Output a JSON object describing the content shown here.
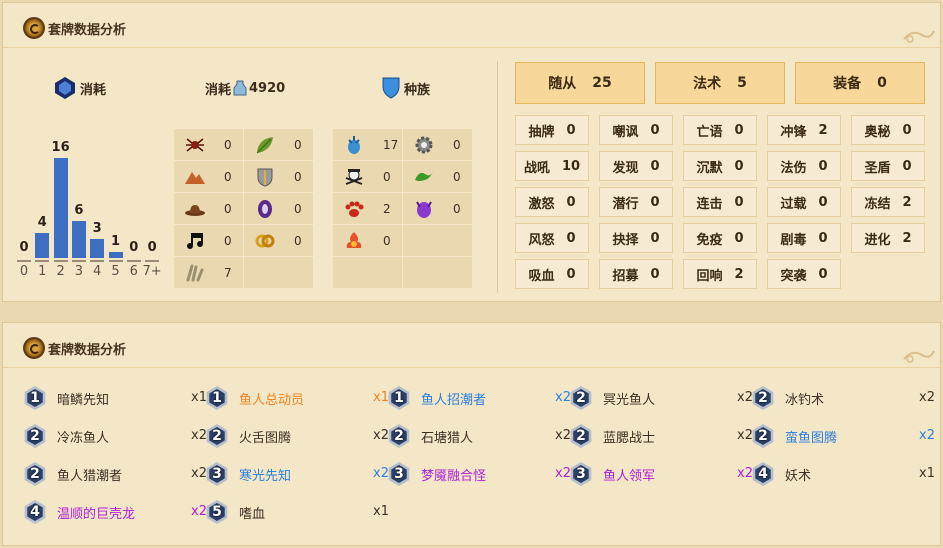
{
  "panel1": {
    "title": "套牌数据分析",
    "cost_header": "消耗",
    "dust_label": "消耗",
    "dust_value": "4920",
    "race_header": "种族"
  },
  "chart_data": {
    "type": "bar",
    "categories": [
      "0",
      "1",
      "2",
      "3",
      "4",
      "5",
      "6",
      "7+"
    ],
    "values": [
      0,
      4,
      16,
      6,
      3,
      1,
      0,
      0
    ],
    "title": "",
    "xlabel": "",
    "ylabel": "",
    "ylim": [
      0,
      16
    ]
  },
  "mechanic_grid": [
    {
      "icon": "spider-icon",
      "value": "0"
    },
    {
      "icon": "leaf-icon",
      "value": "0"
    },
    {
      "icon": "mountain-icon",
      "value": "0"
    },
    {
      "icon": "shield-icon",
      "value": "0"
    },
    {
      "icon": "hat-icon",
      "value": "0"
    },
    {
      "icon": "purple-rune-icon",
      "value": "0"
    },
    {
      "icon": "music-note-icon",
      "value": "0"
    },
    {
      "icon": "knot-icon",
      "value": "0"
    },
    {
      "icon": "claw-icon",
      "value": "7"
    }
  ],
  "race_grid": [
    {
      "icon": "murloc-icon",
      "value": "17"
    },
    {
      "icon": "mech-gear-icon",
      "value": "0"
    },
    {
      "icon": "pirate-icon",
      "value": "0"
    },
    {
      "icon": "dragon-icon",
      "value": "0"
    },
    {
      "icon": "beast-paw-icon",
      "value": "2"
    },
    {
      "icon": "demon-icon",
      "value": "0"
    },
    {
      "icon": "elemental-icon",
      "value": "0"
    }
  ],
  "type_totals": [
    {
      "label": "随从",
      "value": "25"
    },
    {
      "label": "法术",
      "value": "5"
    },
    {
      "label": "装备",
      "value": "0"
    }
  ],
  "keywords": [
    {
      "label": "抽牌",
      "value": "0"
    },
    {
      "label": "嘲讽",
      "value": "0"
    },
    {
      "label": "亡语",
      "value": "0"
    },
    {
      "label": "冲锋",
      "value": "2"
    },
    {
      "label": "奥秘",
      "value": "0"
    },
    {
      "label": "战吼",
      "value": "10"
    },
    {
      "label": "发现",
      "value": "0"
    },
    {
      "label": "沉默",
      "value": "0"
    },
    {
      "label": "法伤",
      "value": "0"
    },
    {
      "label": "圣盾",
      "value": "0"
    },
    {
      "label": "激怒",
      "value": "0"
    },
    {
      "label": "潜行",
      "value": "0"
    },
    {
      "label": "连击",
      "value": "0"
    },
    {
      "label": "过载",
      "value": "0"
    },
    {
      "label": "冻结",
      "value": "2"
    },
    {
      "label": "风怒",
      "value": "0"
    },
    {
      "label": "抉择",
      "value": "0"
    },
    {
      "label": "免疫",
      "value": "0"
    },
    {
      "label": "剧毒",
      "value": "0"
    },
    {
      "label": "进化",
      "value": "2"
    },
    {
      "label": "吸血",
      "value": "0"
    },
    {
      "label": "招募",
      "value": "0"
    },
    {
      "label": "回响",
      "value": "2"
    },
    {
      "label": "突袭",
      "value": "0"
    }
  ],
  "panel2": {
    "title": "套牌数据分析"
  },
  "cards": [
    {
      "cost": "1",
      "name": "暗鳞先知",
      "count": "x1",
      "rarity": "common"
    },
    {
      "cost": "1",
      "name": "鱼人总动员",
      "count": "x1",
      "rarity": "legend"
    },
    {
      "cost": "1",
      "name": "鱼人招潮者",
      "count": "x2",
      "rarity": "rare"
    },
    {
      "cost": "2",
      "name": "冥光鱼人",
      "count": "x2",
      "rarity": "common"
    },
    {
      "cost": "2",
      "name": "冰钓术",
      "count": "x2",
      "rarity": "common"
    },
    {
      "cost": "2",
      "name": "冷冻鱼人",
      "count": "x2",
      "rarity": "common"
    },
    {
      "cost": "2",
      "name": "火舌图腾",
      "count": "x2",
      "rarity": "common"
    },
    {
      "cost": "2",
      "name": "石塘猎人",
      "count": "x2",
      "rarity": "common"
    },
    {
      "cost": "2",
      "name": "蓝腮战士",
      "count": "x2",
      "rarity": "common"
    },
    {
      "cost": "2",
      "name": "蛮鱼图腾",
      "count": "x2",
      "rarity": "rare"
    },
    {
      "cost": "2",
      "name": "鱼人猎潮者",
      "count": "x2",
      "rarity": "common"
    },
    {
      "cost": "3",
      "name": "寒光先知",
      "count": "x2",
      "rarity": "rare"
    },
    {
      "cost": "3",
      "name": "梦魇融合怪",
      "count": "x2",
      "rarity": "epic"
    },
    {
      "cost": "3",
      "name": "鱼人领军",
      "count": "x2",
      "rarity": "epic"
    },
    {
      "cost": "4",
      "name": "妖术",
      "count": "x1",
      "rarity": "common"
    },
    {
      "cost": "4",
      "name": "温顺的巨壳龙",
      "count": "x2",
      "rarity": "epic"
    },
    {
      "cost": "5",
      "name": "嗜血",
      "count": "x1",
      "rarity": "common"
    }
  ]
}
